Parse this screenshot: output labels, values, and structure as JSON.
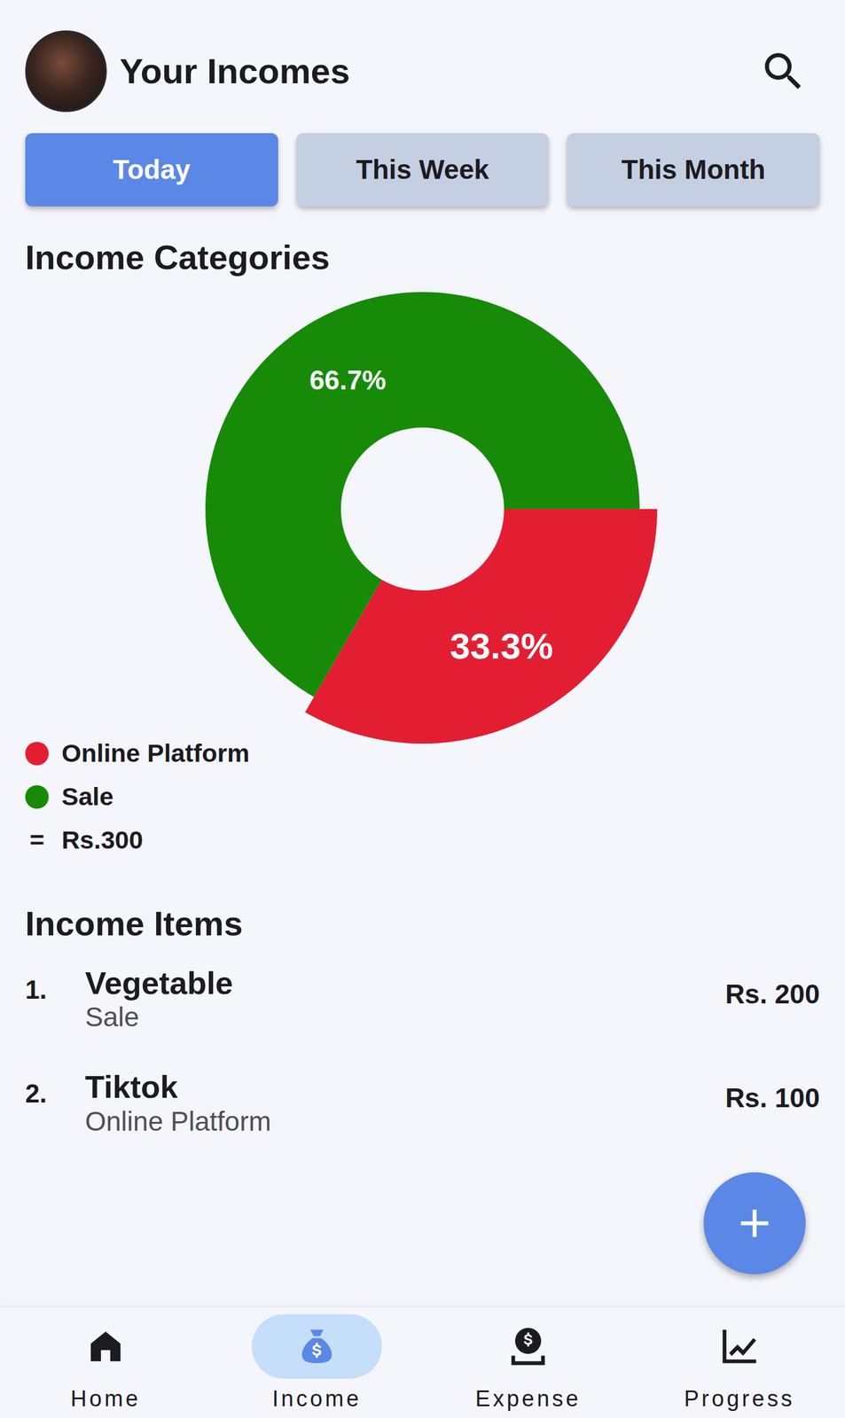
{
  "header": {
    "title": "Your Incomes"
  },
  "tabs": [
    {
      "label": "Today",
      "selected": true
    },
    {
      "label": "This Week",
      "selected": false
    },
    {
      "label": "This Month",
      "selected": false
    }
  ],
  "chart": {
    "title": "Income Categories",
    "series": [
      {
        "name": "Online Platform",
        "value": 100,
        "label": "33.3%",
        "color": "#e31e33",
        "selected": true
      },
      {
        "name": "Sale",
        "value": 200,
        "label": "66.7%",
        "color": "#178a08",
        "selected": false
      }
    ],
    "total_icon": "=",
    "total": "Rs.300"
  },
  "items": {
    "title": "Income Items",
    "rows": [
      {
        "index": "1.",
        "name": "Vegetable",
        "category": "Sale",
        "amount": "Rs. 200"
      },
      {
        "index": "2.",
        "name": "Tiktok",
        "category": "Online Platform",
        "amount": "Rs. 100"
      }
    ]
  },
  "nav": [
    {
      "label": "Home",
      "selected": false
    },
    {
      "label": "Income",
      "selected": true
    },
    {
      "label": "Expense",
      "selected": false
    },
    {
      "label": "Progress",
      "selected": false
    }
  ]
}
